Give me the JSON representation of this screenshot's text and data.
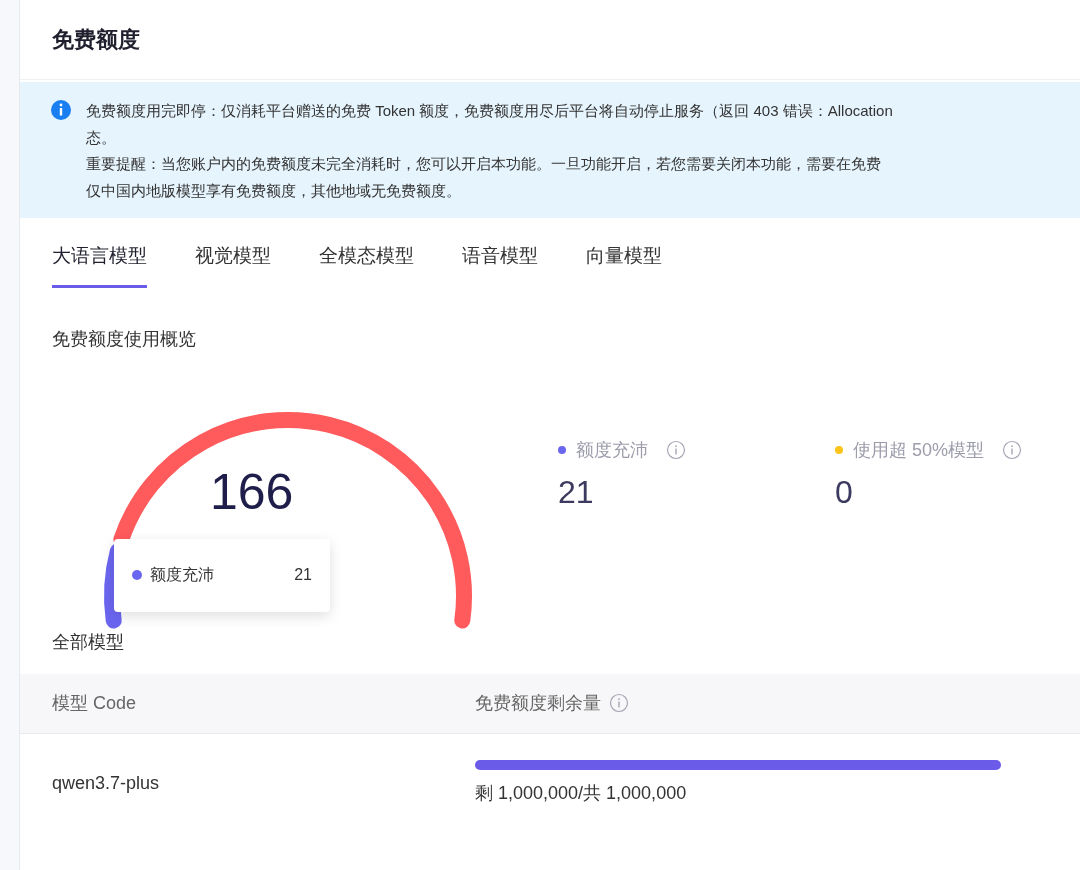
{
  "page": {
    "title": "免费额度"
  },
  "alert": {
    "lines": [
      "免费额度用完即停：仅消耗平台赠送的免费 Token 额度，免费额度用尽后平台将自动停止服务（返回 403 错误：Allocation",
      "态。",
      "重要提醒：当您账户内的免费额度未完全消耗时，您可以开启本功能。一旦功能开启，若您需要关闭本功能，需要在免费",
      "仅中国内地版模型享有免费额度，其他地域无免费额度。"
    ]
  },
  "tabs": [
    {
      "label": "大语言模型",
      "selected": true
    },
    {
      "label": "视觉模型",
      "selected": false
    },
    {
      "label": "全模态模型",
      "selected": false
    },
    {
      "label": "语音模型",
      "selected": false
    },
    {
      "label": "向量模型",
      "selected": false
    }
  ],
  "overview": {
    "title": "免费额度使用概览",
    "gauge": {
      "total": "166"
    },
    "tooltip": {
      "label": "额度充沛",
      "value": "21",
      "color": "#6b66f0"
    },
    "legend": [
      {
        "label": "额度充沛",
        "value": "21",
        "color": "#6b66f0"
      },
      {
        "label": "使用超 50%模型",
        "value": "0",
        "color": "#fcc419"
      }
    ]
  },
  "table": {
    "title": "全部模型",
    "columns": [
      "模型 Code",
      "免费额度剩余量"
    ],
    "rows": [
      {
        "code": "qwen3.7-plus",
        "level": 1,
        "remaining": "剩 1,000,000/共 1,000,000"
      }
    ]
  }
}
